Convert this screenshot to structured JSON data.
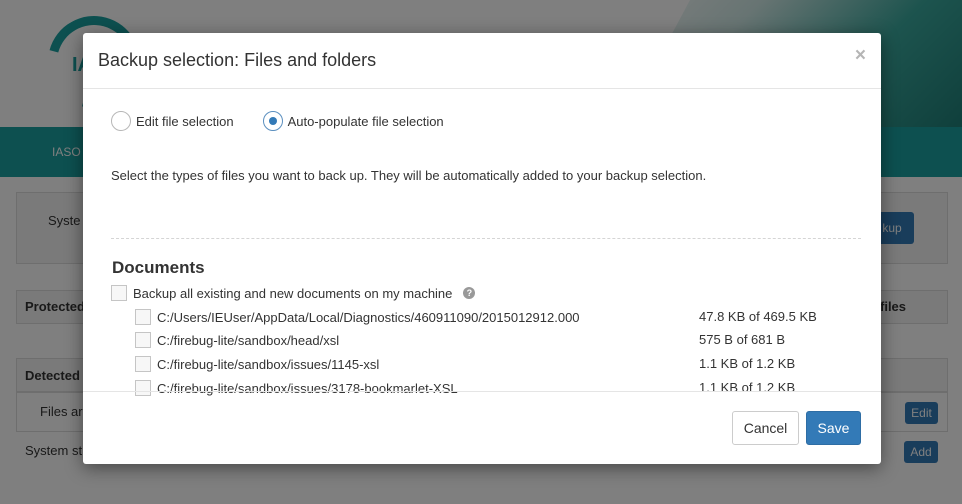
{
  "background": {
    "logo_text": "IA",
    "nav_label": "IASO",
    "system_label": "Syste",
    "backup_button": "kup",
    "protected_label": "Protected",
    "files_label": "files",
    "detected_label": "Detected s",
    "files_row_label": "Files ar",
    "system_state_label": "System st",
    "edit_button": "Edit",
    "add_button": "Add"
  },
  "modal": {
    "title": "Backup selection: Files and folders",
    "close": "×",
    "radio_edit": "Edit file selection",
    "radio_auto": "Auto-populate file selection",
    "selected_radio": "auto",
    "intro": "Select the types of files you want to back up. They will be automatically added to your backup selection.",
    "section_title": "Documents",
    "backup_all_label": "Backup all existing and new documents on my machine",
    "help_icon": "?",
    "files": [
      {
        "path": "C:/Users/IEUser/AppData/Local/Diagnostics/460911090/2015012912.000",
        "size": "47.8 KB of 469.5 KB"
      },
      {
        "path": "C:/firebug-lite/sandbox/head/xsl",
        "size": "575 B of 681 B"
      },
      {
        "path": "C:/firebug-lite/sandbox/issues/1145-xsl",
        "size": "1.1 KB of 1.2 KB"
      },
      {
        "path": "C:/firebug-lite/sandbox/issues/3178-bookmarlet-XSL",
        "size": "1.1 KB of 1.2 KB"
      }
    ],
    "cancel_label": "Cancel",
    "save_label": "Save"
  },
  "colors": {
    "brand_teal": "#1aa1a0",
    "primary_blue": "#337ab7"
  }
}
